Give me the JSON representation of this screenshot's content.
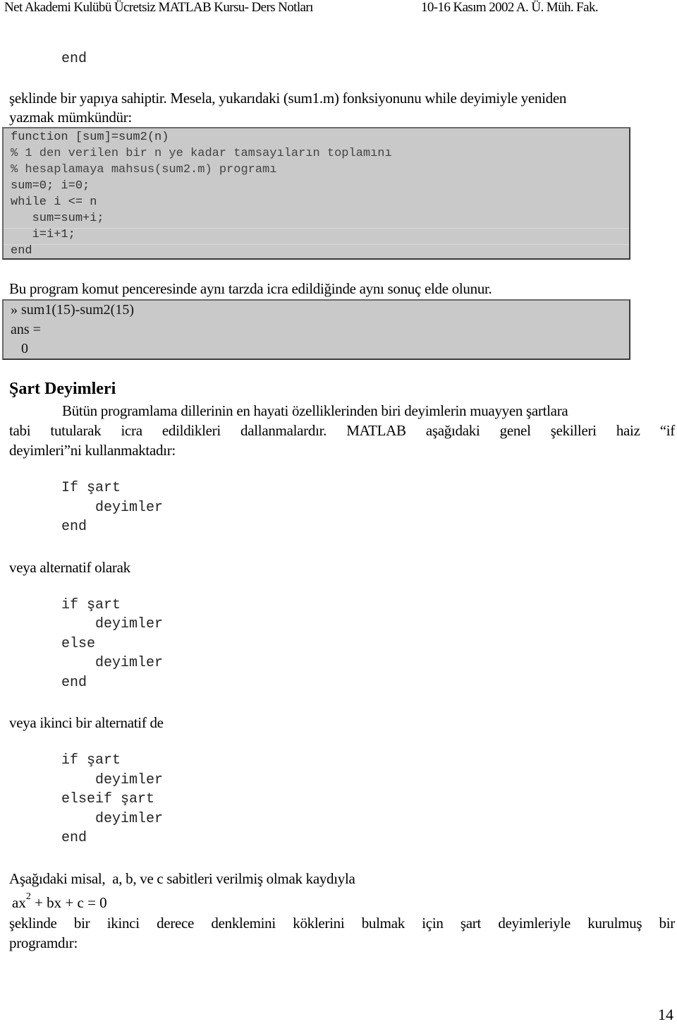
{
  "header": {
    "left": "Net Akademi Kulübü Ücretsiz MATLAB Kursu- Ders Notları",
    "right": "10-16 Kasım 2002 A. Ü. Müh. Fak."
  },
  "top_code_end": "end",
  "intro_paragraph": {
    "line1": "şeklinde bir yapıya sahiptir. Mesela, yukarıdaki (sum1.m) fonksiyonunu while deyimiyle yeniden",
    "line2": "yazmak mümkündür:"
  },
  "code_box_1": {
    "lines": [
      "function [sum]=sum2(n)",
      "% 1 den verilen bir n ye kadar tamsayıların toplamını",
      "% hesaplamaya mahsus(sum2.m) programı",
      "sum=0; i=0;",
      "while i <= n",
      "   sum=sum+i;",
      "   i=i+1;",
      "end"
    ]
  },
  "result_sentence": "Bu program komut penceresinde aynı tarzda icra edildiğinde aynı sonuç elde olunur.",
  "code_box_2": {
    "lines": [
      "» sum1(15)-sum2(15)",
      "ans =",
      "   0"
    ]
  },
  "section": {
    "heading": "Şart Deyimleri",
    "paragraph_line1": "Bütün programlama dillerinin en hayati özelliklerinden biri deyimlerin muayyen şartlara",
    "paragraph_line2": "tabi tutularak icra edildikleri dallanmalardır. MATLAB aşağıdaki genel şekilleri haiz “if",
    "paragraph_line3": "deyimleri”ni kullanmaktadır:"
  },
  "form1": {
    "lines": [
      "If şart",
      "    deyimler",
      "end"
    ]
  },
  "alt1_label": "veya alternatif olarak",
  "form2": {
    "lines": [
      "if şart",
      "    deyimler",
      "else",
      "    deyimler",
      "end"
    ]
  },
  "alt2_label": "veya ikinci bir alternatif de",
  "form3": {
    "lines": [
      "if şart",
      "    deyimler",
      "elseif şart",
      "    deyimler",
      "end"
    ]
  },
  "example": {
    "intro": "Aşağıdaki misal,  a, b, ve c sabitleri verilmiş olmak kaydıyla",
    "equation_pre": "ax",
    "equation_exp": "2",
    "equation_post": " + bx + c = 0",
    "desc_line1": "şeklinde bir ikinci derece denklemini köklerini bulmak için şart deyimleriyle kurulmuş bir",
    "desc_line2": "programdır:"
  },
  "page_number": "14"
}
